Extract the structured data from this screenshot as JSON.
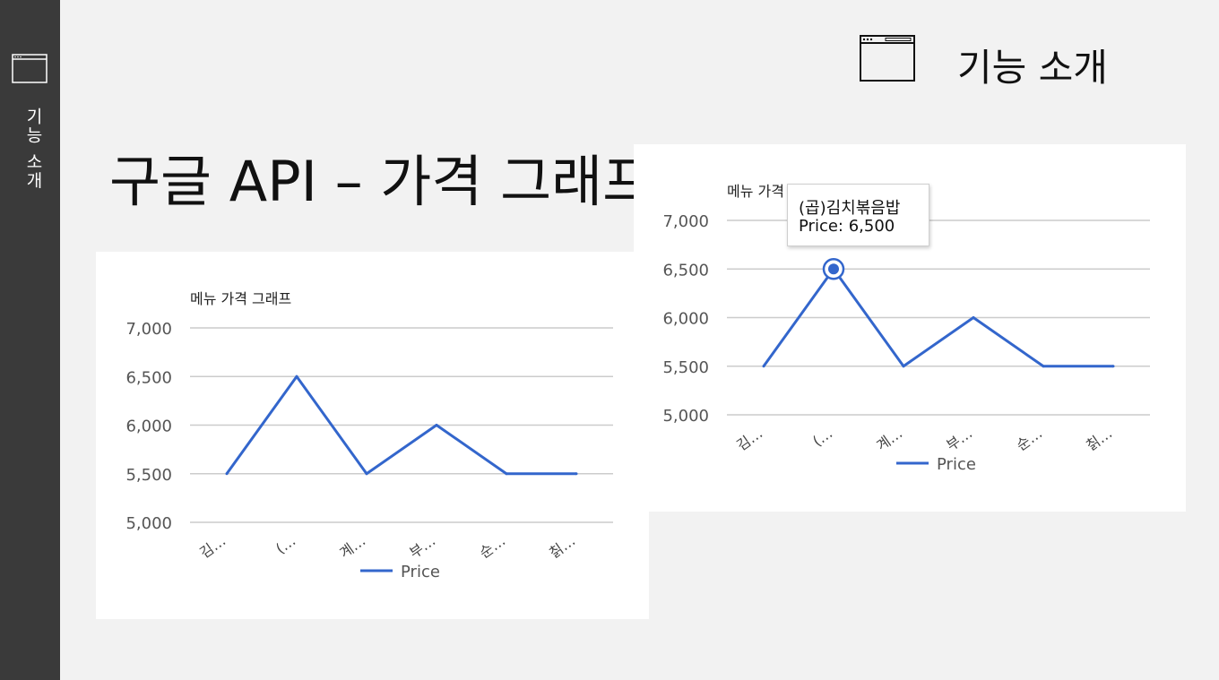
{
  "sidebar": {
    "label": "기능 소개",
    "icon": "browser-window-icon"
  },
  "header": {
    "title": "기능 소개",
    "icon": "browser-window-icon"
  },
  "page_title": "구글 API – 가격 그래프",
  "colors": {
    "line": "#3366cc",
    "grid": "#cccccc",
    "sidebar": "#3a3a3a"
  },
  "tooltip": {
    "title": "(곱)김치볶음밥",
    "label": "Price: 6,500"
  },
  "chart_data": [
    {
      "type": "line",
      "title": "메뉴 가격 그래프",
      "categories": [
        "김…",
        "(…",
        "계…",
        "부…",
        "순…",
        "칡…"
      ],
      "series": [
        {
          "name": "Price",
          "values": [
            5500,
            6500,
            5500,
            6000,
            5500,
            5500
          ]
        }
      ],
      "yticks": [
        "5,000",
        "5,500",
        "6,000",
        "6,500",
        "7,000"
      ],
      "ylim": [
        5000,
        7000
      ],
      "grid": true,
      "legend": "bottom"
    },
    {
      "type": "line",
      "title": "메뉴 가격 그래프",
      "categories": [
        "김…",
        "(…",
        "계…",
        "부…",
        "순…",
        "칡…"
      ],
      "series": [
        {
          "name": "Price",
          "values": [
            5500,
            6500,
            5500,
            6000,
            5500,
            5500
          ]
        }
      ],
      "yticks": [
        "5,000",
        "5,500",
        "6,000",
        "6,500",
        "7,000"
      ],
      "ylim": [
        5000,
        7000
      ],
      "grid": true,
      "legend": "bottom",
      "highlighted_index": 1
    }
  ]
}
